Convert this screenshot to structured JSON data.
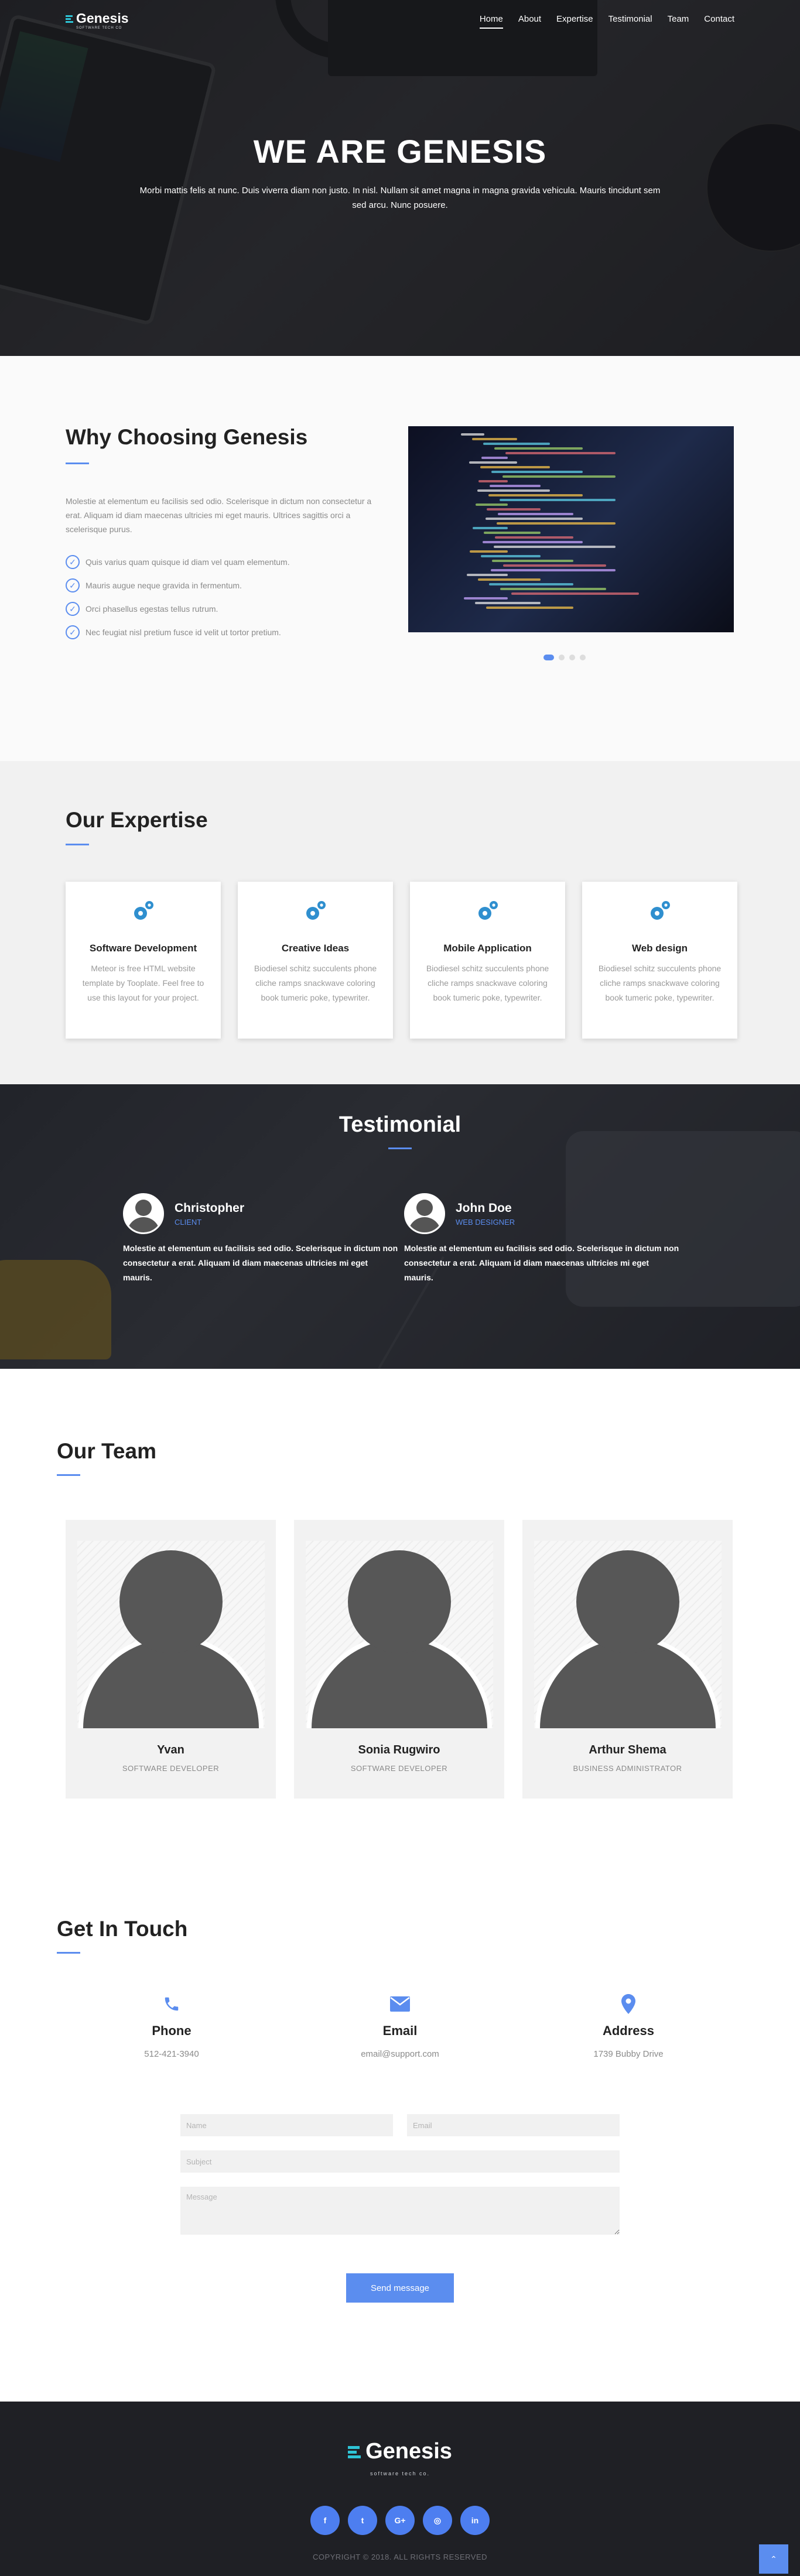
{
  "nav": {
    "brand": "Genesis",
    "tagline": "SOFTWARE TECH CO",
    "items": [
      {
        "label": "Home",
        "active": true
      },
      {
        "label": "About",
        "active": false
      },
      {
        "label": "Expertise",
        "active": false
      },
      {
        "label": "Testimonial",
        "active": false
      },
      {
        "label": "Team",
        "active": false
      },
      {
        "label": "Contact",
        "active": false
      }
    ]
  },
  "hero": {
    "title": "WE ARE GENESIS",
    "subtitle": "Morbi mattis felis at nunc. Duis viverra diam non justo. In nisl. Nullam sit amet magna in magna gravida vehicula. Mauris tincidunt sem sed arcu. Nunc posuere."
  },
  "why": {
    "title": "Why Choosing Genesis",
    "paragraph": "Molestie at elementum eu facilisis sed odio. Scelerisque in dictum non consectetur a erat. Aliquam id diam maecenas ultricies mi eget mauris. Ultrices sagittis orci a scelerisque purus.",
    "list": [
      "Quis varius quam quisque id diam vel quam elementum.",
      "Mauris augue neque gravida in fermentum.",
      "Orci phasellus egestas tellus rutrum.",
      "Nec feugiat nisl pretium fusce id velit ut tortor pretium."
    ],
    "slider_total": 4,
    "slider_active": 1
  },
  "expertise": {
    "title": "Our Expertise",
    "cards": [
      {
        "title": "Software Development",
        "text": "Meteor is free HTML website template by Tooplate. Feel free to use this layout for your project."
      },
      {
        "title": "Creative Ideas",
        "text": "Biodiesel schitz succulents phone cliche ramps snackwave coloring book tumeric poke, typewriter."
      },
      {
        "title": "Mobile Application",
        "text": "Biodiesel schitz succulents phone cliche ramps snackwave coloring book tumeric poke, typewriter."
      },
      {
        "title": "Web design",
        "text": "Biodiesel schitz succulents phone cliche ramps snackwave coloring book tumeric poke, typewriter."
      }
    ]
  },
  "testimonial": {
    "title": "Testimonial",
    "quotes": [
      {
        "name": "Christopher",
        "role": "CLIENT",
        "text": "Molestie at elementum eu facilisis sed odio. Scelerisque in dictum non consectetur a erat. Aliquam id diam maecenas ultricies mi eget mauris."
      },
      {
        "name": "John Doe",
        "role": "WEB DESIGNER",
        "text": "Molestie at elementum eu facilisis sed odio. Scelerisque in dictum non consectetur a erat. Aliquam id diam maecenas ultricies mi eget mauris."
      }
    ]
  },
  "team": {
    "title": "Our Team",
    "members": [
      {
        "name": "Yvan",
        "role": "SOFTWARE DEVELOPER"
      },
      {
        "name": "Sonia Rugwiro",
        "role": "SOFTWARE DEVELOPER"
      },
      {
        "name": "Arthur Shema",
        "role": "BUSINESS ADMINISTRATOR"
      }
    ]
  },
  "contact": {
    "title": "Get In Touch",
    "info": [
      {
        "label": "Phone",
        "value": "512-421-3940",
        "icon": "phone-icon"
      },
      {
        "label": "Email",
        "value": "email@support.com",
        "icon": "envelope-icon"
      },
      {
        "label": "Address",
        "value": "1739 Bubby Drive",
        "icon": "location-pin-icon"
      }
    ],
    "form": {
      "name_placeholder": "Name",
      "email_placeholder": "Email",
      "subject_placeholder": "Subject",
      "message_placeholder": "Message",
      "submit_label": "Send message"
    }
  },
  "footer": {
    "brand": "Genesis",
    "tagline": "software tech co.",
    "socials": [
      {
        "label": "f",
        "icon": "facebook-icon"
      },
      {
        "label": "t",
        "icon": "twitter-icon"
      },
      {
        "label": "G+",
        "icon": "google-plus-icon"
      },
      {
        "label": "◎",
        "icon": "instagram-icon"
      },
      {
        "label": "in",
        "icon": "linkedin-icon"
      }
    ],
    "copyright": "COPYRIGHT © 2018. ALL RIGHTS RESERVED"
  },
  "colors": {
    "accent": "#5b8def",
    "footer_bg": "#1f2025"
  }
}
